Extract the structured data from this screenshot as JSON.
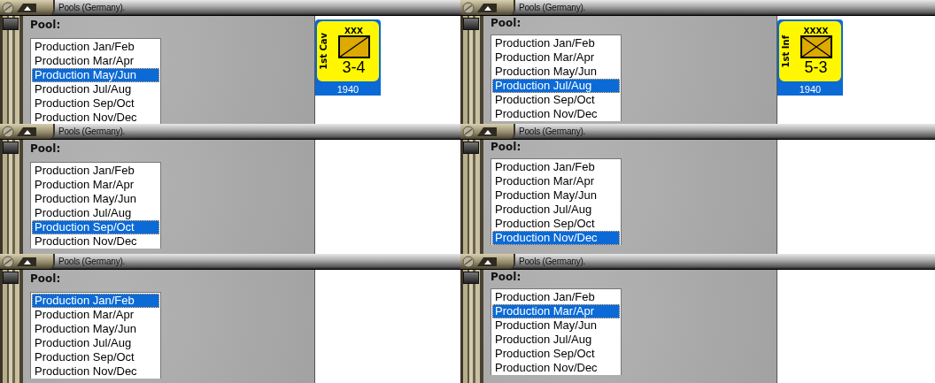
{
  "panels": [
    {
      "title": "Pools (Germany).",
      "label": "Pool:",
      "items": [
        {
          "text": "Production Jan/Feb",
          "selected": false
        },
        {
          "text": "Production Mar/Apr",
          "selected": false
        },
        {
          "text": "Production May/Jun",
          "selected": true
        },
        {
          "text": "Production Jul/Aug",
          "selected": false
        },
        {
          "text": "Production Sep/Oct",
          "selected": false
        },
        {
          "text": "Production Nov/Dec",
          "selected": false
        }
      ],
      "counter": {
        "name": "1st Cav",
        "echelon": "XXX",
        "kind": "cavalry",
        "strength": "3-4",
        "year": "1940"
      }
    },
    {
      "title": "Pools (Germany).",
      "label": "Pool:",
      "items": [
        {
          "text": "Production Jan/Feb",
          "selected": false
        },
        {
          "text": "Production Mar/Apr",
          "selected": false
        },
        {
          "text": "Production May/Jun",
          "selected": false
        },
        {
          "text": "Production Jul/Aug",
          "selected": true
        },
        {
          "text": "Production Sep/Oct",
          "selected": false
        },
        {
          "text": "Production Nov/Dec",
          "selected": false
        }
      ],
      "counter": {
        "name": "1st Inf",
        "echelon": "XXXX",
        "kind": "infantry",
        "strength": "5-3",
        "year": "1940"
      }
    },
    {
      "title": "Pools (Germany).",
      "label": "Pool:",
      "items": [
        {
          "text": "Production Jan/Feb",
          "selected": false
        },
        {
          "text": "Production Mar/Apr",
          "selected": false
        },
        {
          "text": "Production May/Jun",
          "selected": false
        },
        {
          "text": "Production Jul/Aug",
          "selected": false
        },
        {
          "text": "Production Sep/Oct",
          "selected": true
        },
        {
          "text": "Production Nov/Dec",
          "selected": false
        }
      ]
    },
    {
      "title": "Pools (Germany).",
      "label": "Pool:",
      "items": [
        {
          "text": "Production Jan/Feb",
          "selected": false
        },
        {
          "text": "Production Mar/Apr",
          "selected": false
        },
        {
          "text": "Production May/Jun",
          "selected": false
        },
        {
          "text": "Production Jul/Aug",
          "selected": false
        },
        {
          "text": "Production Sep/Oct",
          "selected": false
        },
        {
          "text": "Production Nov/Dec",
          "selected": true
        }
      ]
    },
    {
      "title": "Pools (Germany).",
      "label": "Pool:",
      "items": [
        {
          "text": "Production Jan/Feb",
          "selected": true
        },
        {
          "text": "Production Mar/Apr",
          "selected": false
        },
        {
          "text": "Production May/Jun",
          "selected": false
        },
        {
          "text": "Production Jul/Aug",
          "selected": false
        },
        {
          "text": "Production Sep/Oct",
          "selected": false
        },
        {
          "text": "Production Nov/Dec",
          "selected": false
        }
      ]
    },
    {
      "title": "Pools (Germany).",
      "label": "Pool:",
      "items": [
        {
          "text": "Production Jan/Feb",
          "selected": false
        },
        {
          "text": "Production Mar/Apr",
          "selected": true
        },
        {
          "text": "Production May/Jun",
          "selected": false
        },
        {
          "text": "Production Jul/Aug",
          "selected": false
        },
        {
          "text": "Production Sep/Oct",
          "selected": false
        },
        {
          "text": "Production Nov/Dec",
          "selected": false
        }
      ]
    }
  ]
}
